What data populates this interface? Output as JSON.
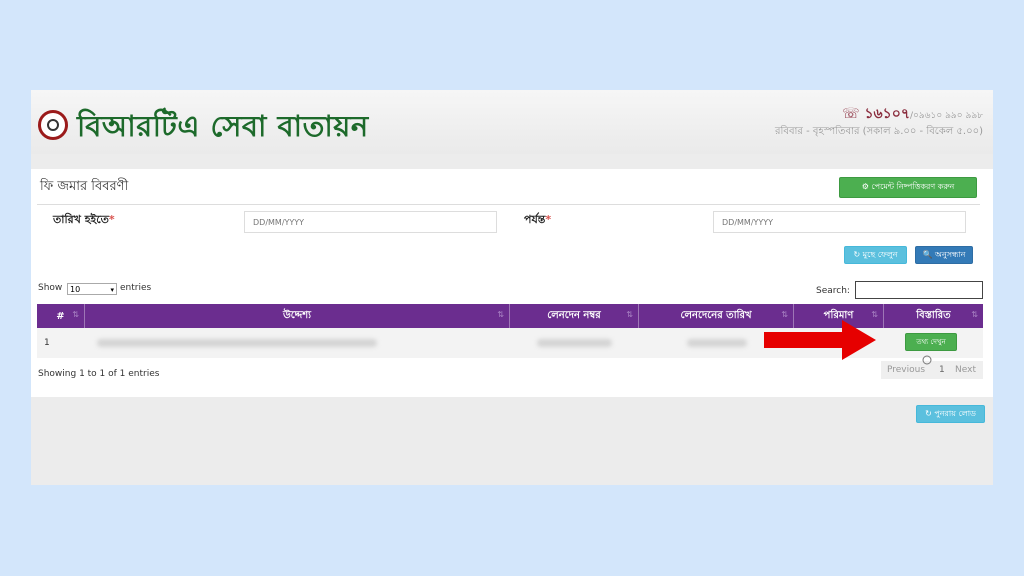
{
  "header": {
    "site_title": "বিআরটিএ সেবা বাতায়ন",
    "hotline_number": "☏ ১৬১০৭",
    "hotline_alt": "/০৯৬১০ ৯৯০ ৯৯৮",
    "office_hours": "রবিবার - বৃহস্পতিবার (সকাল ৯.০০ - বিকেল ৫.০০)"
  },
  "panel": {
    "title": "ফি জমার বিবরণী",
    "verify_button": "⚙ পেমেন্ট নিষ্পত্তিকরণ করুন"
  },
  "filters": {
    "from_label": "তারিখ হইতে",
    "to_label": "পর্যন্ত",
    "required_mark": "*",
    "from_placeholder": "DD/MM/YYYY",
    "to_placeholder": "DD/MM/YYYY",
    "reset_button": "↻ মুছে ফেলুন",
    "search_button": "🔍 অনুসন্ধান"
  },
  "table_controls": {
    "show_label": "Show",
    "entries_value": "10",
    "entries_label": "entries",
    "search_label": "Search:"
  },
  "table": {
    "headers": [
      "#",
      "উদ্দেশ্য",
      "লেনদেন নম্বর",
      "লেনদেনের তারিখ",
      "পরিমাণ",
      "বিস্তারিত"
    ],
    "rows": [
      {
        "index": "1",
        "detail_button": "তথ্য দেখুন"
      }
    ]
  },
  "pagination": {
    "info": "Showing 1 to 1 of 1 entries",
    "previous": "Previous",
    "page": "1",
    "next": "Next"
  },
  "footer": {
    "refresh_button": "↻ পুনরায় লোড"
  },
  "colors": {
    "brand_green": "#1d6a2b",
    "table_header": "#6b2d8f",
    "annotation_arrow": "#e60000"
  }
}
